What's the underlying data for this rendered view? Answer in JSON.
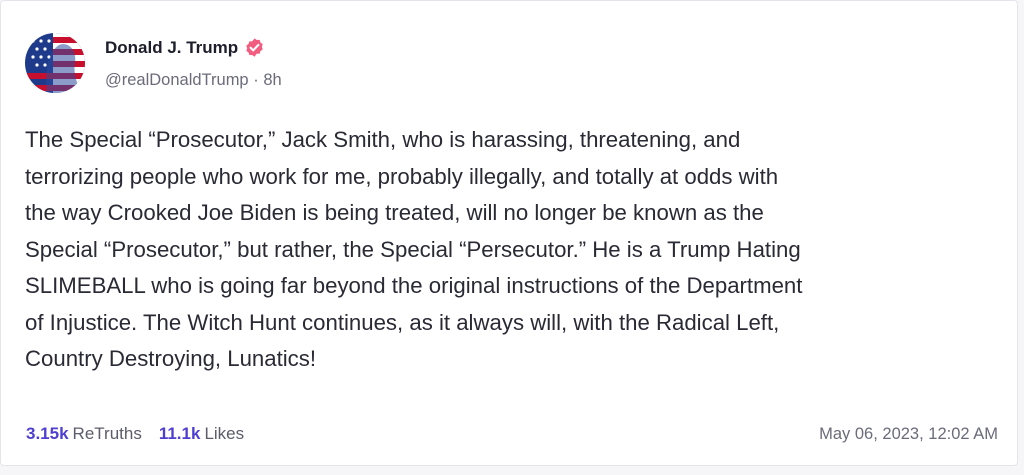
{
  "author": {
    "display_name": "Donald J. Trump",
    "handle": "@realDonaldTrump",
    "separator": "·",
    "age": "8h",
    "verified_color": "#f25c7e"
  },
  "post": {
    "text": "The Special “Prosecutor,” Jack Smith, who is harassing, threatening, and\nterrorizing people who work for me, probably illegally, and totally at odds with\nthe way Crooked Joe Biden is being treated, will no longer be known as the\nSpecial “Prosecutor,” but rather, the Special “Persecutor.” He is a Trump Hating\nSLIMEBALL who is going far beyond the original instructions of the Department\nof Injustice. The Witch Hunt continues, as it always will, with the Radical Left,\nCountry Destroying, Lunatics!"
  },
  "stats": {
    "retruths_count": "3.15k",
    "retruths_label": "ReTruths",
    "likes_count": "11.1k",
    "likes_label": "Likes"
  },
  "timestamp": "May 06, 2023, 12:02 AM",
  "colors": {
    "accent": "#4f3fd0",
    "text": "#2a2a35",
    "muted": "#6b6b7a"
  }
}
